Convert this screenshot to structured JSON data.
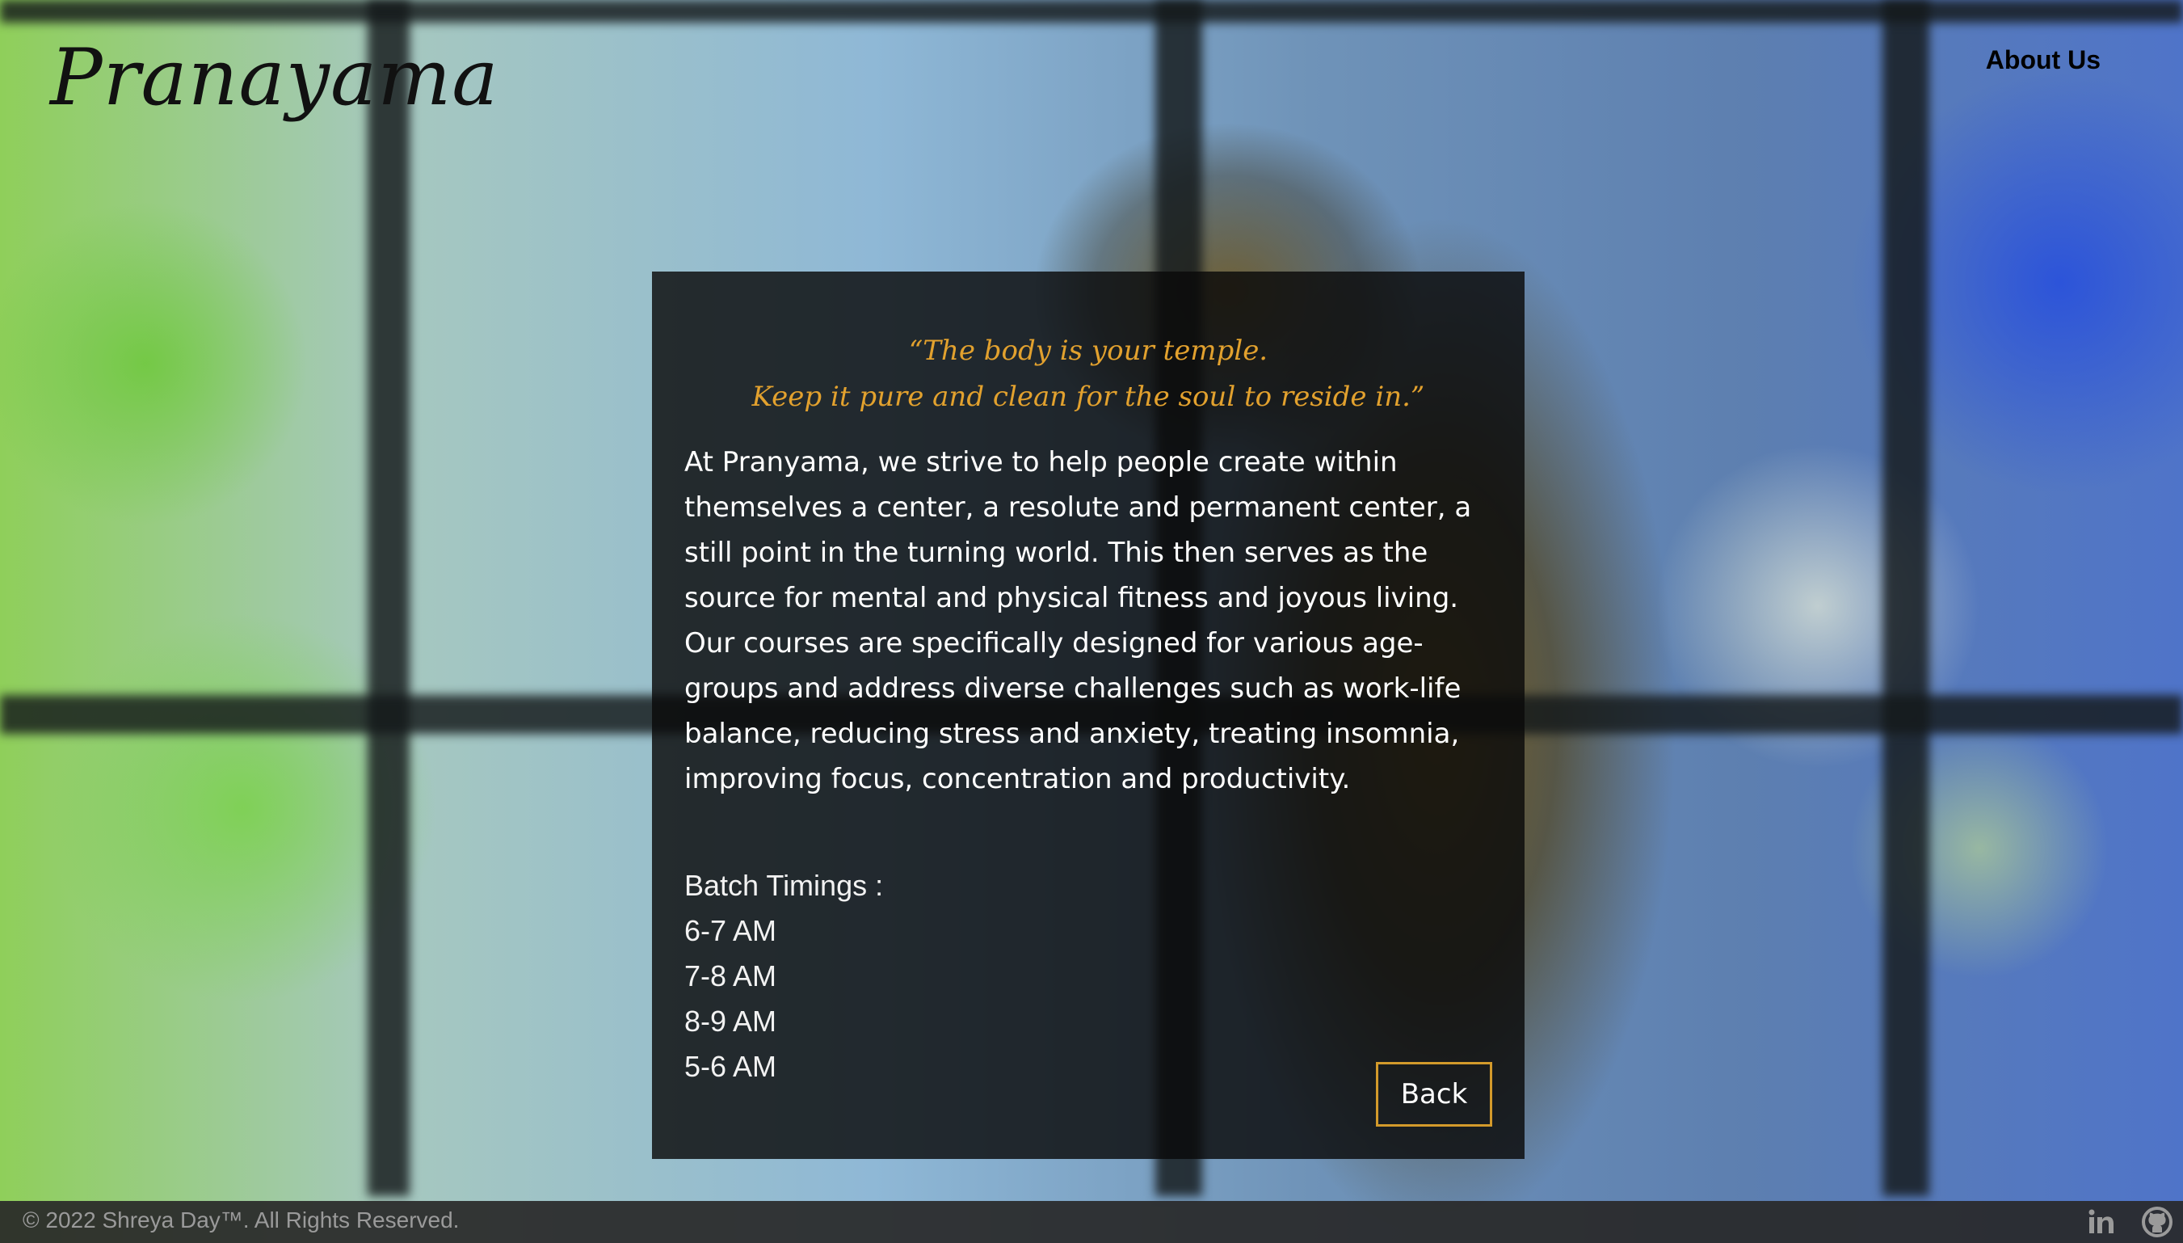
{
  "header": {
    "brand": "Pranayama",
    "nav_about": "About Us"
  },
  "card": {
    "quote_line1": "“The body is your temple.",
    "quote_line2": "Keep it pure and clean for the soul to reside in.”",
    "about_text": "At Pranyama, we strive to help people create within themselves a center, a resolute and permanent center, a still point in the turning world. This then serves as the source for mental and physical fitness and joyous living. Our courses are specifically designed for various age-groups and address diverse challenges such as work-life balance, reducing stress and anxiety, treating insomnia, improving focus, concentration and productivity.",
    "timings_title": "Batch Timings :",
    "timings": [
      "6-7 AM",
      "7-8 AM",
      "8-9 AM",
      "5-6 AM"
    ],
    "back_label": "Back"
  },
  "footer": {
    "copyright": "© 2022 Shreya Day™. All Rights Reserved.",
    "icons": [
      "linkedin-icon",
      "github-icon"
    ]
  },
  "colors": {
    "accent": "#e2a12e",
    "button_border": "#d39a2b",
    "card_bg": "#0a0a0a",
    "footer_bg": "#282828"
  }
}
